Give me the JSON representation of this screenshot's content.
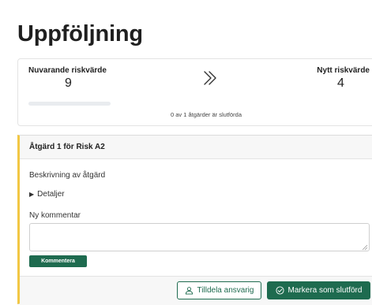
{
  "page": {
    "title": "Uppföljning"
  },
  "summary": {
    "current_label": "Nuvarande riskvärde",
    "current_value": "9",
    "new_label": "Nytt riskvärde",
    "new_value": "4",
    "arrow_icon": "double-chevron-right-icon",
    "progress_fraction": 0,
    "progress_text": "0 av 1 åtgärder är slutförda"
  },
  "action": {
    "title": "Åtgärd 1 för Risk A2",
    "description": "Beskrivning av åtgärd",
    "details_label": "Detaljer",
    "comment_label": "Ny kommentar",
    "comment_value": "",
    "comment_button": "Kommentera",
    "assign_button": "Tilldela ansvarig",
    "assign_icon": "user-icon",
    "complete_button": "Markera som slutförd",
    "complete_icon": "check-circle-icon",
    "accent_color": "#f2c744",
    "primary_color": "#1e6b4f"
  }
}
